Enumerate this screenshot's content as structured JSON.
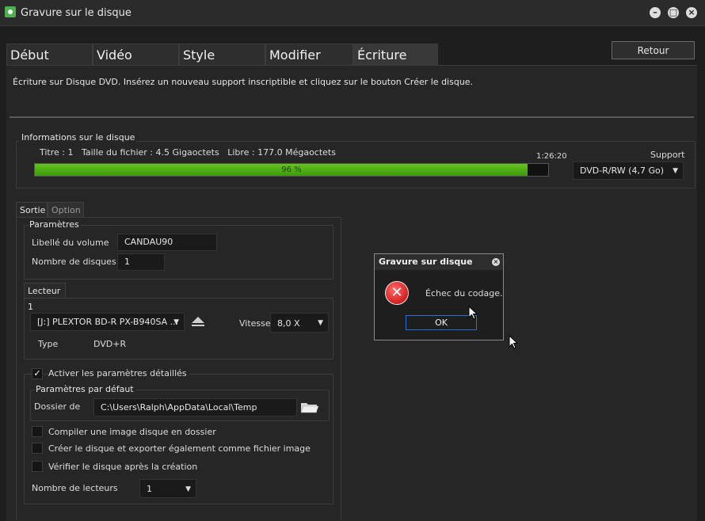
{
  "window": {
    "title": "Gravure sur le disque"
  },
  "tabs": [
    "Début",
    "Vidéo",
    "Style",
    "Modifier",
    "Écriture"
  ],
  "active_tab": "Écriture",
  "retour_label": "Retour",
  "instruction": "Écriture sur Disque DVD. Insérez un nouveau support inscriptible et cliquez sur le bouton Créer le disque.",
  "disk_info": {
    "group_label": "Informations sur le disque",
    "summary": "Titre : 1   Taille du fichier : 4.5 Gigaoctets   Libre : 177.0 Mégaoctets",
    "duration": "1:26:20",
    "progress_text": "96 %",
    "progress_value": 0.96,
    "support_label": "Support",
    "support_value": "DVD-R/RW (4,7 Go)"
  },
  "subtabs": [
    "Sortie",
    "Option"
  ],
  "params": {
    "group_label": "Paramètres",
    "volume_label": "Libellé du volume",
    "volume_value": "CANDAU90",
    "disc_count_label": "Nombre de disques",
    "disc_count_value": "1"
  },
  "drive": {
    "tab_label": "Lecteur 1",
    "drive_value": "[J:] PLEXTOR BD-R  PX-B940SA ...",
    "speed_label": "Vitesse",
    "speed_value": "8,0 X",
    "type_label": "Type",
    "type_value": "DVD+R"
  },
  "advanced": {
    "enable_label": "Activer les paramètres détaillés",
    "enable_check": "✓",
    "defaults_label": "Paramètres par défaut",
    "folder_label": "Dossier de",
    "folder_value": "C:\\Users\\Ralph\\AppData\\Local\\Temp",
    "opt1": "Compiler une image disque en dossier",
    "opt2": "Créer le disque et exporter également comme fichier image",
    "opt3": "Vérifier le disque après la création",
    "readers_label": "Nombre de lecteurs",
    "readers_value": "1"
  },
  "dialog": {
    "title": "Gravure sur disque",
    "message": "Échec du codage.",
    "ok_label": "OK"
  },
  "icons": {
    "minimize": "minimize-icon",
    "restore": "restore-icon",
    "close": "close-icon",
    "eject": "eject-icon",
    "folder": "folder-icon",
    "error": "error-icon"
  }
}
